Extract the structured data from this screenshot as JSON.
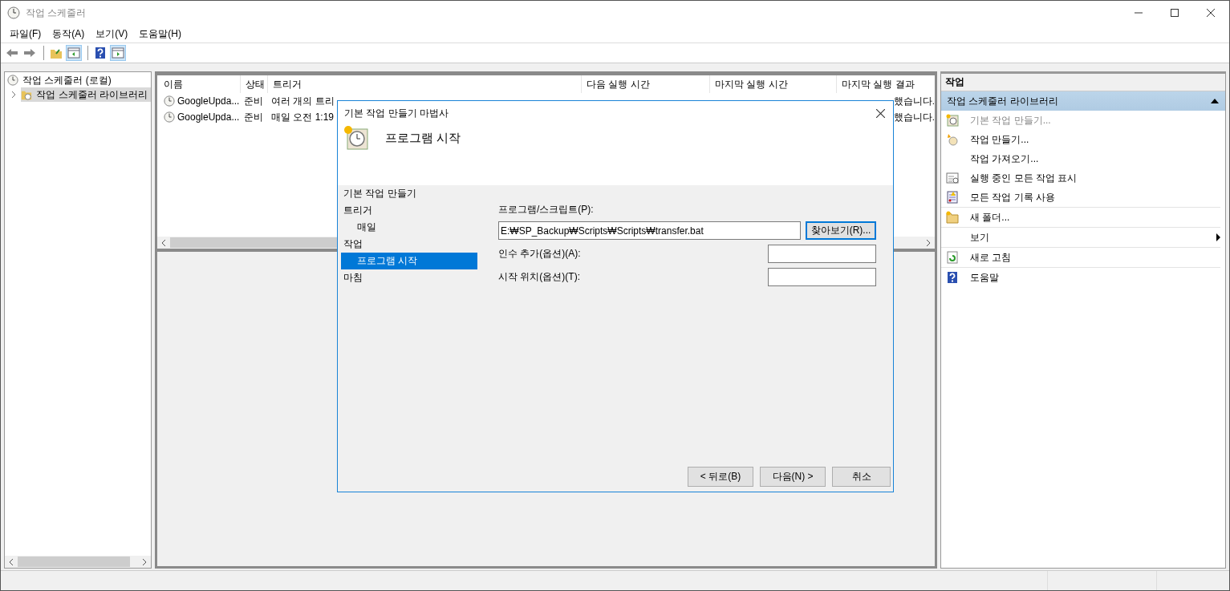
{
  "window": {
    "title": "작업 스케줄러"
  },
  "menu": [
    "파일(F)",
    "동작(A)",
    "보기(V)",
    "도움말(H)"
  ],
  "toolbar": [
    {
      "kind": "back"
    },
    {
      "kind": "forward"
    },
    {
      "kind": "sep"
    },
    {
      "kind": "folder-up"
    },
    {
      "kind": "pane-left",
      "selected": true
    },
    {
      "kind": "sep"
    },
    {
      "kind": "help"
    },
    {
      "kind": "pane-right",
      "selected": true
    }
  ],
  "tree": [
    {
      "label": "작업 스케줄러 (로컬)",
      "selected": false,
      "expanded": true,
      "children": [
        {
          "label": "작업 스케줄러 라이브러리",
          "selected": true,
          "expanded": false
        }
      ]
    }
  ],
  "table": {
    "columns": [
      "이름",
      "상태",
      "트리거",
      "다음 실행 시간",
      "마지막 실행 시간",
      "마지막 실행 결과"
    ],
    "rows": [
      {
        "name": "GoogleUpda...",
        "status": "준비",
        "trigger": "여러 개의 트리",
        "result": "했습니다."
      },
      {
        "name": "GoogleUpda...",
        "status": "준비",
        "trigger": "매일 오전 1:19",
        "result": "했습니다."
      }
    ]
  },
  "actions": {
    "title": "작업",
    "section": "작업 스케줄러 라이브러리",
    "items": [
      {
        "kind": "wizard",
        "label": "기본 작업 만들기...",
        "disabled": true
      },
      {
        "kind": "task",
        "label": "작업 만들기...",
        "disabled": false
      },
      {
        "kind": "none",
        "label": "작업 가져오기...",
        "disabled": false
      },
      {
        "kind": "running",
        "label": "실행 중인 모든 작업 표시",
        "disabled": false
      },
      {
        "kind": "log",
        "label": "모든 작업 기록 사용",
        "disabled": false,
        "divider": true
      },
      {
        "kind": "folder",
        "label": "새 폴더...",
        "disabled": false,
        "divider": true
      },
      {
        "kind": "submenu",
        "label": "보기",
        "disabled": false,
        "divider": true
      },
      {
        "kind": "refresh",
        "label": "새로 고침",
        "disabled": false,
        "divider": true
      },
      {
        "kind": "help",
        "label": "도움말",
        "disabled": false
      }
    ]
  },
  "dialog": {
    "title": "기본 작업 만들기 마법사",
    "heading": "프로그램 시작",
    "steps": [
      {
        "label": "기본 작업 만들기",
        "selected": false
      },
      {
        "label": "트리거",
        "selected": false,
        "children": [
          {
            "label": "매일",
            "selected": false
          }
        ]
      },
      {
        "label": "작업",
        "selected": false,
        "children": [
          {
            "label": "프로그램 시작",
            "selected": true
          }
        ]
      },
      {
        "label": "마침",
        "selected": false
      }
    ],
    "program_label": "프로그램/스크립트(P):",
    "program_value": "E:₩SP_Backup₩Scripts₩Scripts₩transfer.bat",
    "browse": "찾아보기(R)...",
    "fields": [
      {
        "label": "인수 추가(옵션)(A):"
      },
      {
        "label": "시작 위치(옵션)(T):"
      }
    ],
    "buttons": [
      "< 뒤로(B)",
      "다음(N) >",
      "취소"
    ]
  }
}
